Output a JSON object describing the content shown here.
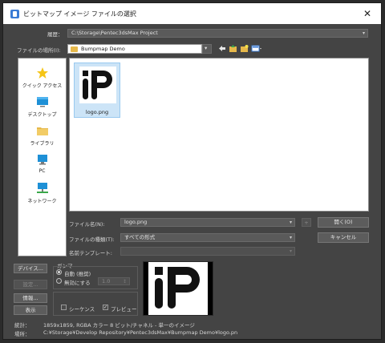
{
  "window": {
    "title": "ビットマップ イメージ ファイルの選択",
    "close_glyph": "✕"
  },
  "history": {
    "label": "履歴：",
    "value": "C:\\Storage\\Pentec3dsMax Project"
  },
  "location": {
    "label": "ファイルの場所(I):",
    "value": "Bumpmap Demo"
  },
  "places": [
    {
      "label": "クイック アクセス",
      "icon": "star-icon"
    },
    {
      "label": "デスクトップ",
      "icon": "desktop-icon"
    },
    {
      "label": "ライブラリ",
      "icon": "library-folder-icon"
    },
    {
      "label": "PC",
      "icon": "pc-icon"
    },
    {
      "label": "ネットワーク",
      "icon": "network-icon"
    }
  ],
  "files": [
    {
      "name": "logo.png",
      "icon": "image-thumbnail-icon"
    }
  ],
  "filename": {
    "label": "ファイル名(N):",
    "value": "logo.png"
  },
  "filetype": {
    "label": "ファイルの種類(T):",
    "value": "すべての形式"
  },
  "template": {
    "label": "名前テンプレート:",
    "value": ""
  },
  "buttons": {
    "open": "開く(O)",
    "cancel": "キャンセル",
    "device": "デバイス...",
    "setup": "設定...",
    "info": "情報...",
    "view": "表示",
    "plus": "+"
  },
  "gamma": {
    "label": "ガンマ",
    "auto": "自動 (推奨)",
    "override": "無効にする",
    "override_value": "1.0"
  },
  "options": {
    "sequence": "シーケンス",
    "preview": "プレビュー",
    "preview_checked": true
  },
  "info": {
    "stats_label": "統計：",
    "stats_value": "1859x1859, RGBA カラー 8 ビット/チャネル - 単一のイメージ",
    "location_label": "場所：",
    "location_value": "C:¥Storage¥Develop Repository¥Pentec3dsMax¥Bumpmap Demo¥logo.pn"
  },
  "colors": {
    "background": "#444444",
    "list_bg": "#ffffff",
    "selection": "#cce4f7"
  }
}
